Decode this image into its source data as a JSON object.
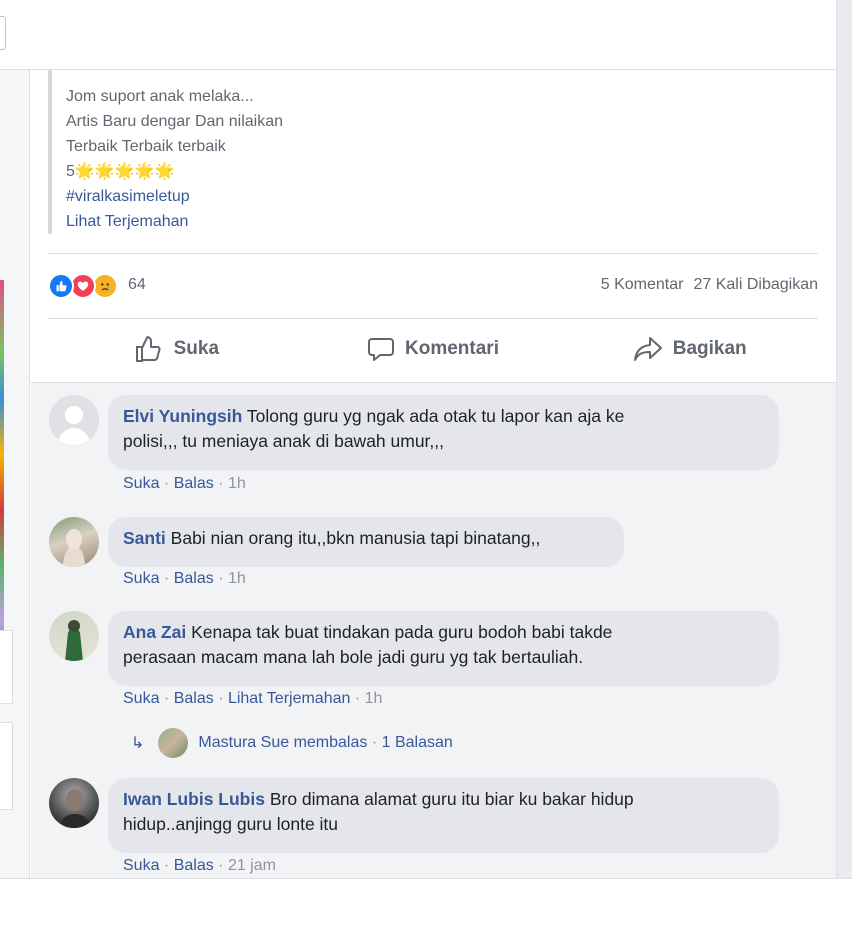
{
  "post": {
    "lines": [
      "Jom suport anak melaka...",
      "Artis Baru dengar Dan nilaikan",
      "Terbaik Terbaik terbaik"
    ],
    "rating_prefix": "5",
    "rating_stars": "🌟🌟🌟🌟🌟",
    "hashtag": "#viralkasimeletup",
    "translate": "Lihat Terjemahan"
  },
  "stats": {
    "reaction_icons": [
      "like-icon",
      "love-icon",
      "sad-icon"
    ],
    "reaction_count": "64",
    "comments": "5 Komentar",
    "shares": "27 Kali Dibagikan"
  },
  "actions": {
    "like": "Suka",
    "comment": "Komentari",
    "share": "Bagikan"
  },
  "comments": [
    {
      "author": "Elvi Yuningsih",
      "lines": [
        "Tolong guru yg ngak ada otak tu lapor kan aja ke",
        "polisi,,, tu meniaya anak di bawah umur,,,"
      ],
      "like": "Suka",
      "reply": "Balas",
      "time": "1h"
    },
    {
      "author": "Santi",
      "lines": [
        "Babi nian orang itu,,bkn manusia tapi binatang,,"
      ],
      "like": "Suka",
      "reply": "Balas",
      "time": "1h"
    },
    {
      "author": "Ana Zai",
      "lines": [
        "Kenapa tak buat tindakan pada guru bodoh babi takde",
        "perasaan macam mana lah bole jadi guru yg tak bertauliah."
      ],
      "like": "Suka",
      "reply": "Balas",
      "translate": "Lihat Terjemahan",
      "time": "1h",
      "reply_summary": {
        "text": "Mastura Sue membalas",
        "count": "1 Balasan"
      }
    },
    {
      "author": "Iwan Lubis Lubis",
      "lines": [
        "Bro dimana alamat guru itu biar ku bakar hidup",
        "hidup..anjingg guru lonte itu"
      ],
      "like": "Suka",
      "reply": "Balas",
      "time": "21 jam"
    }
  ],
  "colors": {
    "link": "#385898",
    "muted": "#606770",
    "bubble": "#e4e6eb",
    "like": "#1877f2",
    "love": "#f33e58",
    "sad": "#f7b125"
  }
}
